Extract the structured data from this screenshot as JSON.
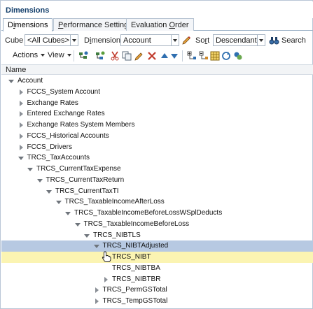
{
  "panel": {
    "title": "Dimensions"
  },
  "tabs": [
    {
      "label_pre": "D",
      "label_u": "i",
      "label_post": "mensions"
    },
    {
      "label_pre": "",
      "label_u": "P",
      "label_post": "erformance Settings"
    },
    {
      "label_pre": "Evaluation ",
      "label_u": "O",
      "label_post": "rder"
    }
  ],
  "filter": {
    "cube_label": "Cube",
    "cube_value": "<All Cubes>",
    "dimension_label_pre": "D",
    "dimension_label_u": "i",
    "dimension_label_post": "mension",
    "dimension_value": "Account",
    "sort_label_pre": "So",
    "sort_label_u": "r",
    "sort_label_post": "t",
    "sort_value": "Descendants",
    "search_label": "Search"
  },
  "toolbar": {
    "actions_label": "Actions",
    "view_label": "View"
  },
  "grid": {
    "column_name": "Name"
  },
  "tree": [
    {
      "label": "Account",
      "level": 0,
      "state": "open"
    },
    {
      "label": "FCCS_System Account",
      "level": 1,
      "state": "closed"
    },
    {
      "label": "Exchange Rates",
      "level": 1,
      "state": "closed"
    },
    {
      "label": "Entered Exchange Rates",
      "level": 1,
      "state": "closed"
    },
    {
      "label": "Exchange Rates System Members",
      "level": 1,
      "state": "closed"
    },
    {
      "label": "FCCS_Historical Accounts",
      "level": 1,
      "state": "closed"
    },
    {
      "label": "FCCS_Drivers",
      "level": 1,
      "state": "closed"
    },
    {
      "label": "TRCS_TaxAccounts",
      "level": 1,
      "state": "open"
    },
    {
      "label": "TRCS_CurrentTaxExpense",
      "level": 2,
      "state": "open"
    },
    {
      "label": "TRCS_CurrentTaxReturn",
      "level": 3,
      "state": "open"
    },
    {
      "label": "TRCS_CurrentTaxTI",
      "level": 4,
      "state": "open"
    },
    {
      "label": "TRCS_TaxableIncomeAfterLoss",
      "level": 5,
      "state": "open"
    },
    {
      "label": "TRCS_TaxableIncomeBeforeLossWSplDeducts",
      "level": 6,
      "state": "open"
    },
    {
      "label": "TRCS_TaxableIncomeBeforeLoss",
      "level": 7,
      "state": "open"
    },
    {
      "label": "TRCS_NIBTLS",
      "level": 8,
      "state": "open"
    },
    {
      "label": "TRCS_NIBTAdjusted",
      "level": 9,
      "state": "open",
      "highlight": "selected"
    },
    {
      "label": "TRCS_NIBT",
      "level": 10,
      "state": "none",
      "highlight": "hover"
    },
    {
      "label": "TRCS_NIBTBA",
      "level": 10,
      "state": "none"
    },
    {
      "label": "TRCS_NIBTBR",
      "level": 10,
      "state": "closed"
    },
    {
      "label": "TRCS_PermGSTotal",
      "level": 9,
      "state": "closed"
    },
    {
      "label": "TRCS_TempGSTotal",
      "level": 9,
      "state": "closed"
    }
  ],
  "colors": {
    "title": "#123e6b",
    "selected_row": "#b7c9e2",
    "hover_row": "#fbf4b2",
    "accent_icon": "#2f6fb0"
  }
}
